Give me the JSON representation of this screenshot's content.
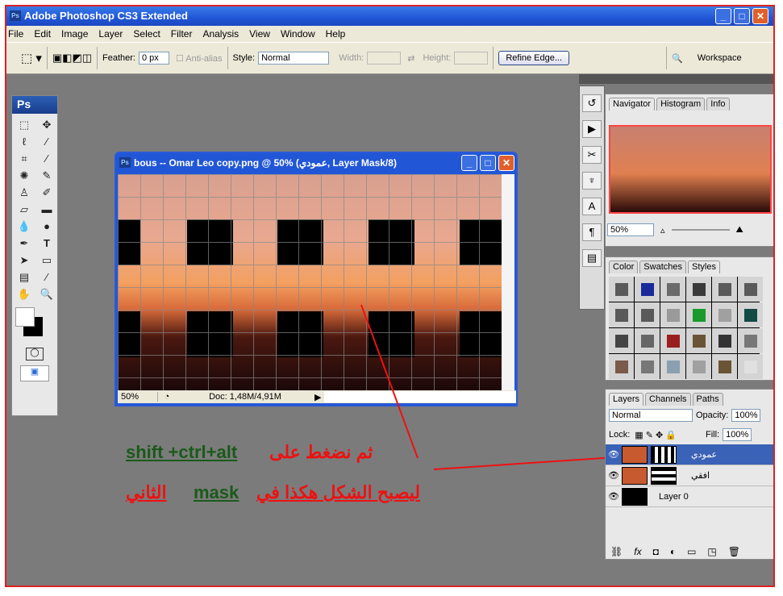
{
  "app": {
    "title": "Adobe Photoshop CS3 Extended",
    "logo": "Ps"
  },
  "window_buttons": {
    "minimize": "_",
    "maximize": "□",
    "close": "✕"
  },
  "menu": [
    "File",
    "Edit",
    "Image",
    "Layer",
    "Select",
    "Filter",
    "Analysis",
    "View",
    "Window",
    "Help"
  ],
  "options": {
    "feather_label": "Feather:",
    "feather_value": "0 px",
    "antialias": "Anti-alias",
    "style_label": "Style:",
    "style_value": "Normal",
    "width_label": "Width:",
    "height_label": "Height:",
    "refine": "Refine Edge...",
    "workspace": "Workspace"
  },
  "toolbox": {
    "header": "Ps",
    "tools": [
      "marquee",
      "move",
      "lasso",
      "magic-wand",
      "crop",
      "slice",
      "healing",
      "brush",
      "stamp",
      "history-brush",
      "eraser",
      "gradient",
      "blur",
      "dodge",
      "pen",
      "type",
      "path-select",
      "shape",
      "notes",
      "eyedropper",
      "hand",
      "zoom"
    ]
  },
  "document": {
    "title": "bous -- Omar Leo copy.png @ 50% (عمودي, Layer Mask/8)",
    "zoom": "50%",
    "doc_info": "Doc: 1,48M/4,91M"
  },
  "navigator": {
    "tabs": [
      "Navigator",
      "Histogram",
      "Info"
    ],
    "zoom": "50%"
  },
  "styles_panel": {
    "tabs": [
      "Color",
      "Swatches",
      "Styles"
    ],
    "swatches": [
      "#5a5a5a",
      "#1a2a9a",
      "#6a6a6a",
      "#3a3a3a",
      "#5a5a5a",
      "#5a5a5a",
      "#5a5a5a",
      "#5a5a5a",
      "#9a9a9a",
      "#1a9a2a",
      "#a0a0a0",
      "#124a44",
      "#444",
      "#666",
      "#9a2020",
      "#6a5436",
      "#333",
      "#777",
      "#7a5a4a",
      "#777",
      "#8aa0b0",
      "#a0a0a0",
      "#6a5436",
      "#e0e0e0"
    ]
  },
  "layers": {
    "tabs": [
      "Layers",
      "Channels",
      "Paths"
    ],
    "blend": "Normal",
    "opacity_label": "Opacity:",
    "opacity": "100%",
    "lock_label": "Lock:",
    "fill_label": "Fill:",
    "fill": "100%",
    "items": [
      {
        "name": "عمودي",
        "selected": true
      },
      {
        "name": "افقي",
        "selected": false
      },
      {
        "name": "Layer 0",
        "selected": false
      }
    ]
  },
  "annotation": {
    "line1_en": "shift +ctrl+alt",
    "line1_ar": "ثم نضغط على",
    "line2_ar_a": "ليصبح الشكل هكذا في",
    "line2_en": "mask",
    "line2_ar_b": "الثاني"
  }
}
